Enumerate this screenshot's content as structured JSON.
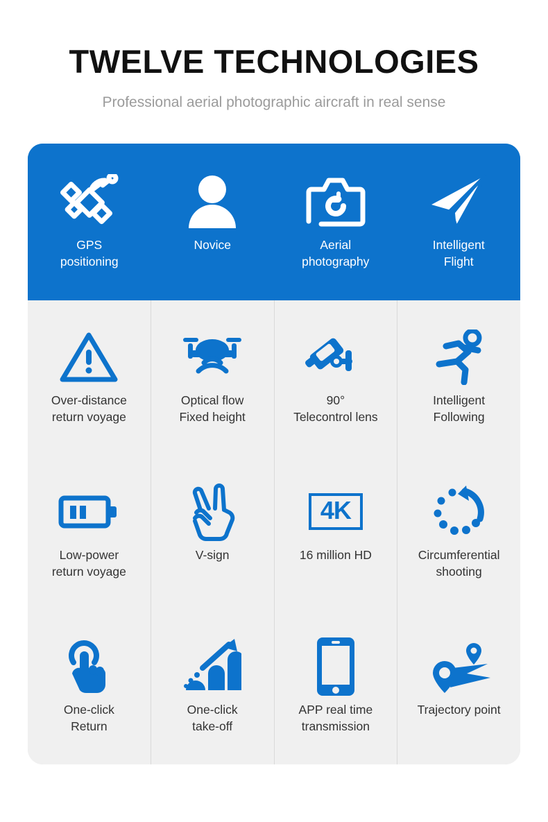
{
  "header": {
    "title": "TWELVE TECHNOLOGIES",
    "subtitle": "Professional aerial photographic aircraft in real sense"
  },
  "colors": {
    "brand_blue": "#0d73cc",
    "panel_gray": "#f0f0f0",
    "divider": "#dcdcdc",
    "title_text": "#111111",
    "subtitle_text": "#9b9b9b",
    "label_text": "#333333"
  },
  "features": [
    {
      "label": "GPS\npositioning",
      "icon": "satellite-icon",
      "highlighted": true
    },
    {
      "label": "Novice",
      "icon": "person-icon",
      "highlighted": true
    },
    {
      "label": "Aerial\nphotography",
      "icon": "camera-icon",
      "highlighted": true
    },
    {
      "label": "Intelligent\nFlight",
      "icon": "paper-plane-icon",
      "highlighted": true
    },
    {
      "label": "Over-distance\nreturn voyage",
      "icon": "warning-triangle-icon",
      "highlighted": false
    },
    {
      "label": "Optical flow\nFixed height",
      "icon": "drone-signal-icon",
      "highlighted": false
    },
    {
      "label": "90°\nTelecontrol lens",
      "icon": "gimbal-camera-icon",
      "highlighted": false
    },
    {
      "label": "Intelligent\nFollowing",
      "icon": "running-person-icon",
      "highlighted": false
    },
    {
      "label": "Low-power\nreturn voyage",
      "icon": "battery-icon",
      "highlighted": false
    },
    {
      "label": "V-sign",
      "icon": "v-sign-hand-icon",
      "highlighted": false
    },
    {
      "label": "16 million HD",
      "icon": "4k-badge-icon",
      "highlighted": false,
      "icon_text": "4K"
    },
    {
      "label": "Circumferential\nshooting",
      "icon": "circular-arrow-icon",
      "highlighted": false
    },
    {
      "label": "One-click\nReturn",
      "icon": "tap-hand-icon",
      "highlighted": false
    },
    {
      "label": "One-click\ntake-off",
      "icon": "growth-chart-icon",
      "highlighted": false
    },
    {
      "label": "APP real time\ntransmission",
      "icon": "smartphone-icon",
      "highlighted": false
    },
    {
      "label": "Trajectory point",
      "icon": "route-pins-icon",
      "highlighted": false
    }
  ]
}
